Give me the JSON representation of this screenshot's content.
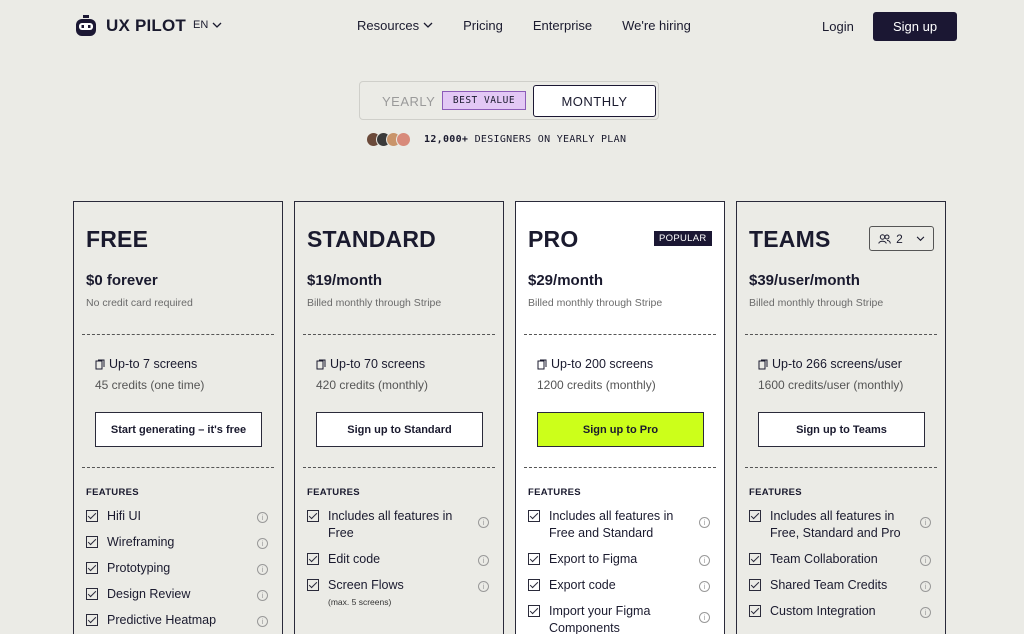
{
  "nav": {
    "logo_text": "UX PILOT",
    "lang": "EN",
    "links": [
      "Resources",
      "Pricing",
      "Enterprise",
      "We're hiring"
    ],
    "login": "Login",
    "signup": "Sign up"
  },
  "toggle": {
    "yearly": "YEARLY",
    "badge": "BEST VALUE",
    "monthly": "MONTHLY",
    "selected": "MONTHLY"
  },
  "social": {
    "count": "12,000+",
    "text": " DESIGNERS ON YEARLY PLAN"
  },
  "plans": [
    {
      "name": "FREE",
      "price": "$0 forever",
      "note": "No credit card required",
      "screens": "Up-to 7 screens",
      "credits": "45 credits (one time)",
      "cta": "Start generating – it's free",
      "features_label": "FEATURES",
      "features": [
        {
          "text": "Hifi UI"
        },
        {
          "text": "Wireframing"
        },
        {
          "text": "Prototyping"
        },
        {
          "text": "Design Review"
        },
        {
          "text": "Predictive Heatmap"
        }
      ]
    },
    {
      "name": "STANDARD",
      "price": "$19/month",
      "note": "Billed monthly through Stripe",
      "screens": "Up-to 70 screens",
      "credits": "420 credits (monthly)",
      "cta": "Sign up to Standard",
      "features_label": "FEATURES",
      "features": [
        {
          "text": "Includes all features in Free"
        },
        {
          "text": "Edit code"
        },
        {
          "text": "Screen Flows",
          "sub": "(max. 5 screens)"
        }
      ]
    },
    {
      "name": "PRO",
      "badge": "POPULAR",
      "price": "$29/month",
      "note": "Billed monthly through Stripe",
      "screens": "Up-to 200 screens",
      "credits": "1200 credits (monthly)",
      "cta": "Sign up to Pro",
      "features_label": "FEATURES",
      "features": [
        {
          "text": "Includes all features in Free and Standard"
        },
        {
          "text": "Export to Figma"
        },
        {
          "text": "Export code"
        },
        {
          "text": "Import your Figma Components"
        }
      ]
    },
    {
      "name": "TEAMS",
      "seats": "2",
      "price": "$39/user/month",
      "note": "Billed monthly through Stripe",
      "screens": "Up-to 266 screens/user",
      "credits": "1600 credits/user (monthly)",
      "cta": "Sign up to Teams",
      "features_label": "FEATURES",
      "features": [
        {
          "text": "Includes all features in Free, Standard and Pro"
        },
        {
          "text": "Team Collaboration"
        },
        {
          "text": "Shared Team Credits"
        },
        {
          "text": "Custom Integration"
        }
      ]
    }
  ],
  "colors": {
    "background": "#ebebe6",
    "primary_dark": "#1b1733",
    "pro_cta": "#ccff1a",
    "best_value_bg": "#e3c8f5"
  },
  "icons": {
    "logo": "robot-pilot-icon",
    "screens": "screens-icon",
    "info": "info-icon",
    "check": "checkbox-checked-icon",
    "seats": "users-icon"
  }
}
